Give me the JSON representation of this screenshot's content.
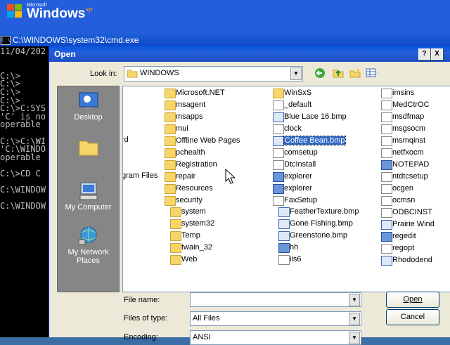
{
  "desktop": {
    "brand_small": "Microsoft",
    "brand": "Windows",
    "brand_sup": "xp"
  },
  "cmd": {
    "title": "C:\\WINDOWS\\system32\\cmd.exe",
    "icon_text": "C:\\",
    "lines": [
      "11/04/202",
      "",
      "",
      "C:\\>",
      "C:\\>",
      "C:\\>",
      "C:\\>",
      "C:\\>C:SYS",
      "'C' is no",
      "operable",
      "",
      "C:\\>C:\\WI",
      "'C:\\WINDO",
      "operable",
      "",
      "C:\\>CD C",
      "",
      "C:\\WINDOW",
      "",
      "C:\\WINDOW"
    ]
  },
  "dialog": {
    "title": "Open",
    "help_button": "?",
    "close_button": "X",
    "look_in_label": "Look in:",
    "look_in_value": "WINDOWS",
    "places": [
      {
        "label": "Desktop",
        "icon": "desktop-icon"
      },
      {
        "label": "",
        "icon": "folder-icon"
      },
      {
        "label": "My Computer",
        "icon": "my-computer-icon"
      },
      {
        "label": "My Network Places",
        "icon": "network-places-icon"
      }
    ],
    "partial_col": [
      "rd",
      "gram Files"
    ],
    "col1": [
      {
        "name": "Microsoft.NET",
        "type": "folder"
      },
      {
        "name": "msagent",
        "type": "folder"
      },
      {
        "name": "msapps",
        "type": "folder"
      },
      {
        "name": "mui",
        "type": "folder"
      },
      {
        "name": "Offline Web Pages",
        "type": "folder"
      },
      {
        "name": "pchealth",
        "type": "folder"
      },
      {
        "name": "Registration",
        "type": "folder"
      },
      {
        "name": "repair",
        "type": "folder"
      },
      {
        "name": "Resources",
        "type": "folder"
      },
      {
        "name": "security",
        "type": "folder"
      }
    ],
    "col1b": [
      {
        "name": "system",
        "type": "folder"
      },
      {
        "name": "system32",
        "type": "folder"
      },
      {
        "name": "Temp",
        "type": "folder"
      },
      {
        "name": "twain_32",
        "type": "folder"
      },
      {
        "name": "Web",
        "type": "folder"
      }
    ],
    "col2": [
      {
        "name": "WinSxS",
        "type": "folder"
      },
      {
        "name": "_default",
        "type": "file"
      },
      {
        "name": "Blue Lace 16.bmp",
        "type": "bmp"
      },
      {
        "name": "clock",
        "type": "file"
      },
      {
        "name": "Coffee Bean.bmp",
        "type": "bmp",
        "selected": true
      },
      {
        "name": "comsetup",
        "type": "file"
      },
      {
        "name": "DtcInstall",
        "type": "file"
      },
      {
        "name": "explorer",
        "type": "exe"
      },
      {
        "name": "explorer",
        "type": "exe"
      },
      {
        "name": "FaxSetup",
        "type": "file"
      }
    ],
    "col2b": [
      {
        "name": "FeatherTexture.bmp",
        "type": "bmp"
      },
      {
        "name": "Gone Fishing.bmp",
        "type": "bmp"
      },
      {
        "name": "Greenstone.bmp",
        "type": "bmp"
      },
      {
        "name": "hh",
        "type": "exe"
      },
      {
        "name": "iis6",
        "type": "file"
      }
    ],
    "col3": [
      {
        "name": "imsins",
        "type": "file"
      },
      {
        "name": "MedCtrOC",
        "type": "file"
      },
      {
        "name": "msdfmap",
        "type": "file"
      },
      {
        "name": "msgsocm",
        "type": "file"
      },
      {
        "name": "msmqinst",
        "type": "file"
      },
      {
        "name": "netfxocm",
        "type": "file"
      },
      {
        "name": "NOTEPAD",
        "type": "exe"
      },
      {
        "name": "ntdtcsetup",
        "type": "file"
      },
      {
        "name": "ocgen",
        "type": "file"
      },
      {
        "name": "ocmsn",
        "type": "file"
      },
      {
        "name": "ODBCINST",
        "type": "file"
      },
      {
        "name": "Prairie Wind",
        "type": "bmp"
      },
      {
        "name": "regedit",
        "type": "exe"
      },
      {
        "name": "regopt",
        "type": "file"
      },
      {
        "name": "Rhododend",
        "type": "bmp"
      }
    ],
    "file_name_label": "File name:",
    "file_name_value": "",
    "files_of_type_label": "Files of type:",
    "files_of_type_value": "All Files",
    "encoding_label": "Encoding:",
    "encoding_value": "ANSI",
    "open_button": "Open",
    "cancel_button": "Cancel"
  }
}
